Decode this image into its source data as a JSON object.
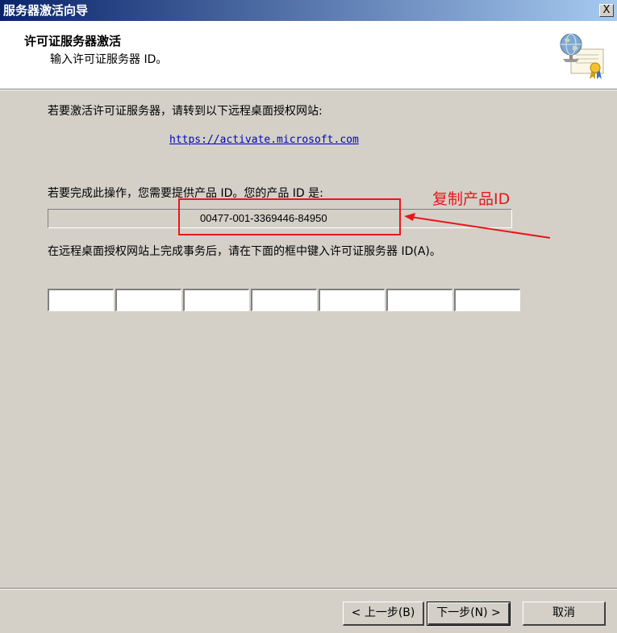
{
  "window": {
    "title": "服务器激活向导",
    "close_label": "X"
  },
  "header": {
    "title": "许可证服务器激活",
    "subtitle": "输入许可证服务器 ID。",
    "icon": "certificate-globe-icon"
  },
  "body": {
    "instruction_1": "若要激活许可证服务器，请转到以下远程桌面授权网站:",
    "activation_url": "https://activate.microsoft.com",
    "instruction_2": "若要完成此操作，您需要提供产品 ID。您的产品 ID 是:",
    "product_id": "00477-001-3369446-84950",
    "instruction_3": "在远程桌面授权网站上完成事务后，请在下面的框中键入许可证服务器 ID(A)。",
    "license_server_id_fields": [
      "",
      "",
      "",
      "",
      "",
      "",
      ""
    ]
  },
  "annotation": {
    "label": "复制产品ID",
    "color": "#e8161b"
  },
  "footer": {
    "back_label": "< 上一步(B)",
    "next_label": "下一步(N) >",
    "cancel_label": "取消"
  }
}
